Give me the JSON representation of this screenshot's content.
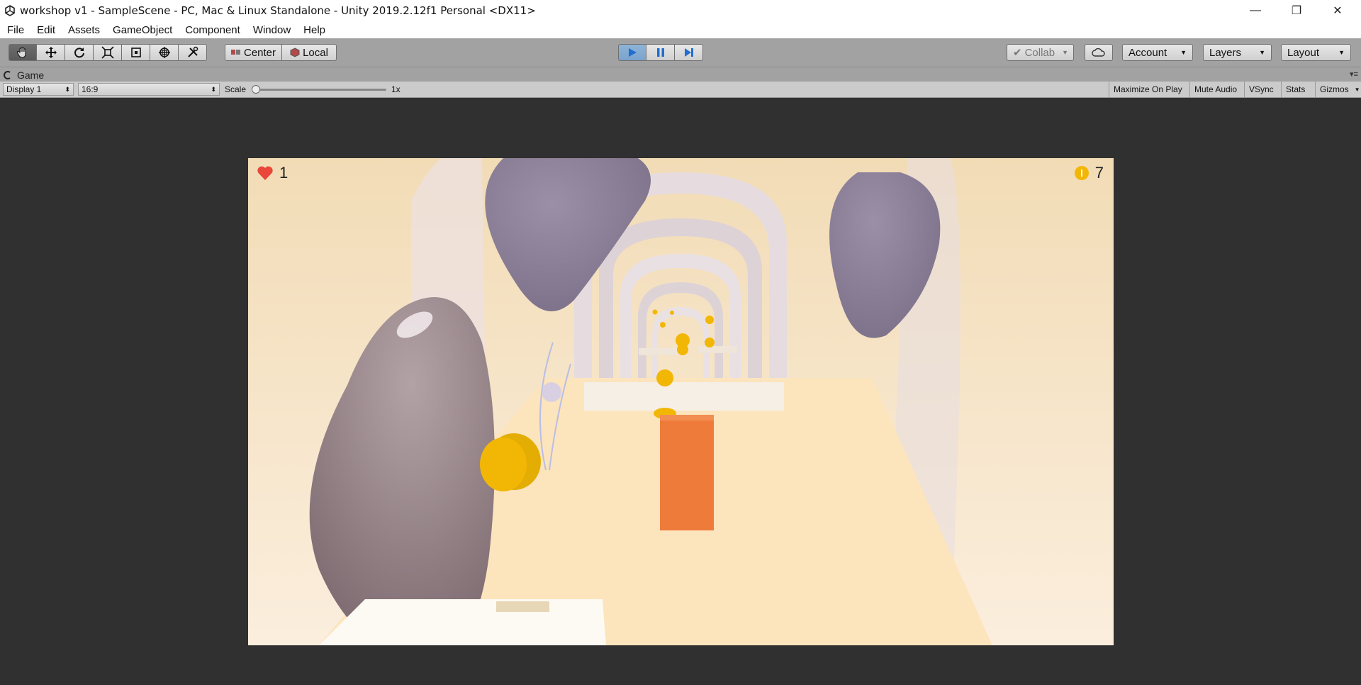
{
  "window": {
    "title": "workshop v1 - SampleScene - PC, Mac & Linux Standalone - Unity 2019.2.12f1 Personal <DX11>",
    "controls": {
      "minimize": "—",
      "restore": "❐",
      "close": "✕"
    }
  },
  "menu": [
    "File",
    "Edit",
    "Assets",
    "GameObject",
    "Component",
    "Window",
    "Help"
  ],
  "toolbar": {
    "transform_tools": [
      "hand-tool",
      "move-tool",
      "rotate-tool",
      "scale-tool",
      "rect-tool",
      "transform-tool",
      "custom-tool"
    ],
    "pivot_label": "Center",
    "space_label": "Local",
    "collab_label": "Collab",
    "account_label": "Account",
    "layers_label": "Layers",
    "layout_label": "Layout"
  },
  "panel": {
    "tab_label": "Game"
  },
  "gamebar": {
    "display": "Display 1",
    "aspect": "16:9",
    "scale_label": "Scale",
    "scale_value": "1x",
    "toggles": [
      "Maximize On Play",
      "Mute Audio",
      "VSync",
      "Stats",
      "Gizmos"
    ]
  },
  "hud": {
    "lives": "1",
    "coins": "7"
  },
  "colors": {
    "toolbar_bg": "#a2a2a2",
    "play_active": "#7ba3cc",
    "play_icon": "#1f6fd1",
    "editor_bg": "#303030",
    "heart": "#e8473a",
    "coin": "#f2b705",
    "player_block": "#ee7b3a",
    "road": "#fbe3bb",
    "sky": "#f5e3c2"
  }
}
